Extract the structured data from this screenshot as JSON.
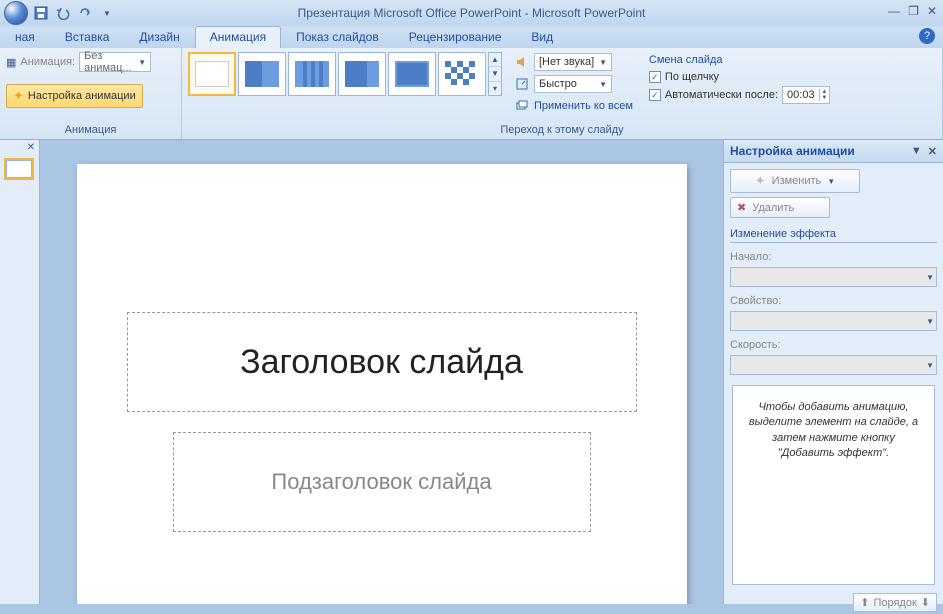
{
  "title": "Презентация Microsoft Office PowerPoint - Microsoft PowerPoint",
  "tabs": [
    "ная",
    "Вставка",
    "Дизайн",
    "Анимация",
    "Показ слайдов",
    "Рецензирование",
    "Вид"
  ],
  "active_tab": 3,
  "group1": {
    "anim_label": "Анимация:",
    "anim_value": "Без анимац...",
    "config_btn": "Настройка анимации",
    "title": "Анимация"
  },
  "group2": {
    "sound_value": "[Нет звука]",
    "speed_value": "Быстро",
    "apply_all": "Применить ко всем",
    "adv_title": "Смена слайда",
    "on_click": "По щелчку",
    "auto_after": "Автоматически после:",
    "auto_time": "00:03",
    "title": "Переход к этому слайду"
  },
  "slide": {
    "title_ph": "Заголовок слайда",
    "sub_ph": "Подзаголовок слайда"
  },
  "taskpane": {
    "header": "Настройка анимации",
    "change_btn": "Изменить",
    "delete_btn": "Удалить",
    "section": "Изменение эффекта",
    "start_label": "Начало:",
    "prop_label": "Свойство:",
    "speed_label": "Скорость:",
    "info": "Чтобы добавить анимацию, выделите элемент на слайде, а затем нажмите кнопку \"Добавить эффект\".",
    "order": "Порядок"
  }
}
